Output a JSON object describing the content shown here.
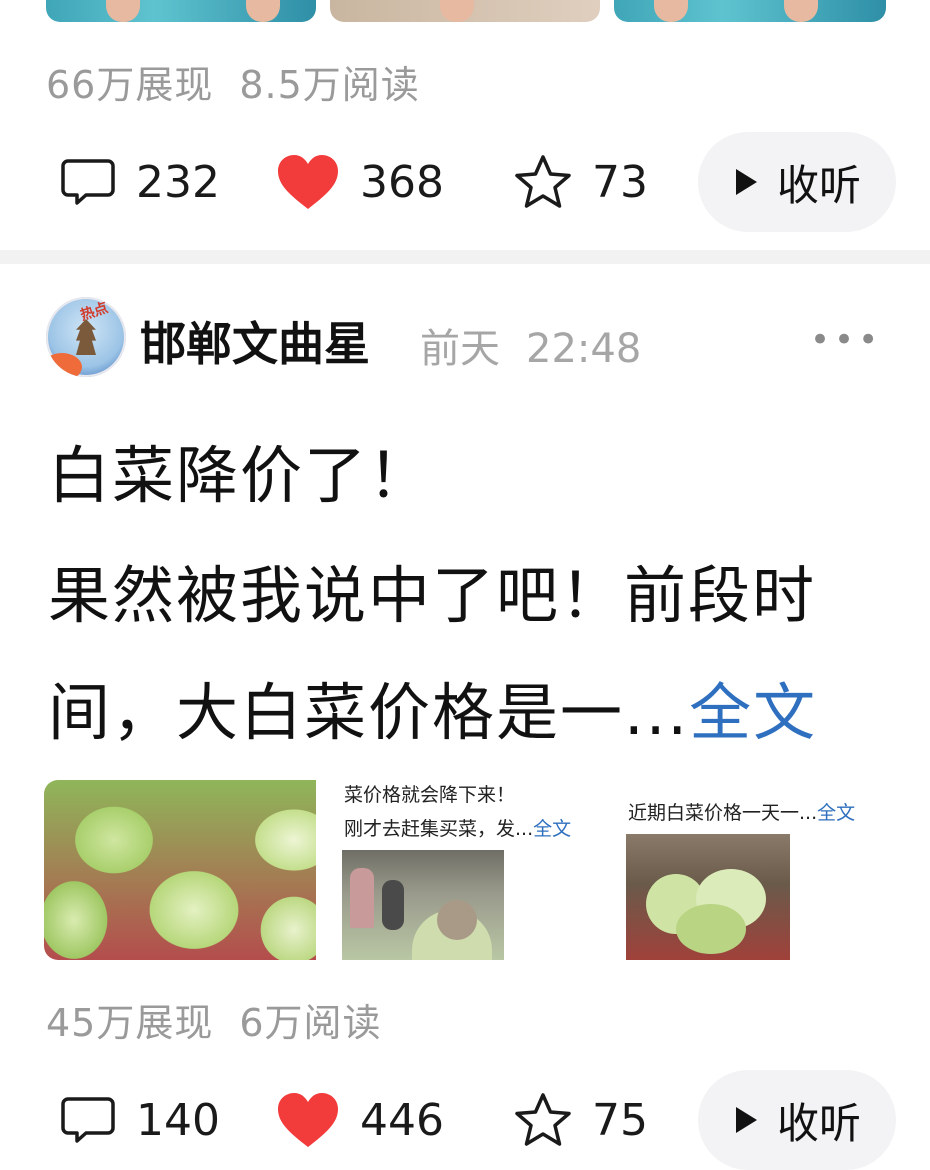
{
  "post1": {
    "stats": {
      "impressions": "66万展现",
      "reads": "8.5万阅读"
    },
    "actions": {
      "comments": "232",
      "likes": "368",
      "favorites": "73",
      "listen_label": "收听"
    }
  },
  "post2": {
    "author": "邯郸文曲星",
    "badge_text": "热点",
    "time_day": "前天",
    "time_clock": "22:48",
    "more_label": "•••",
    "text_line1": "白菜降价了！",
    "text_line2": "果然被我说中了吧！前段时",
    "text_line3": "间，大白菜价格是一...",
    "full_text_link": "全文",
    "card2": {
      "line1": "菜价格就会降下来！",
      "line2": "刚才去赶集买菜，发...",
      "link": "全文"
    },
    "card3": {
      "line1": "近期白菜价格一天一...",
      "link": "全文"
    },
    "stats": {
      "impressions": "45万展现",
      "reads": "6万阅读"
    },
    "actions": {
      "comments": "140",
      "likes": "446",
      "favorites": "75",
      "listen_label": "收听"
    }
  },
  "colors": {
    "heart": "#f23b3b",
    "link": "#2f6fbf",
    "muted": "#9a9a9a"
  },
  "icons": [
    "comment-icon",
    "heart-icon",
    "star-icon",
    "play-icon",
    "more-icon"
  ]
}
